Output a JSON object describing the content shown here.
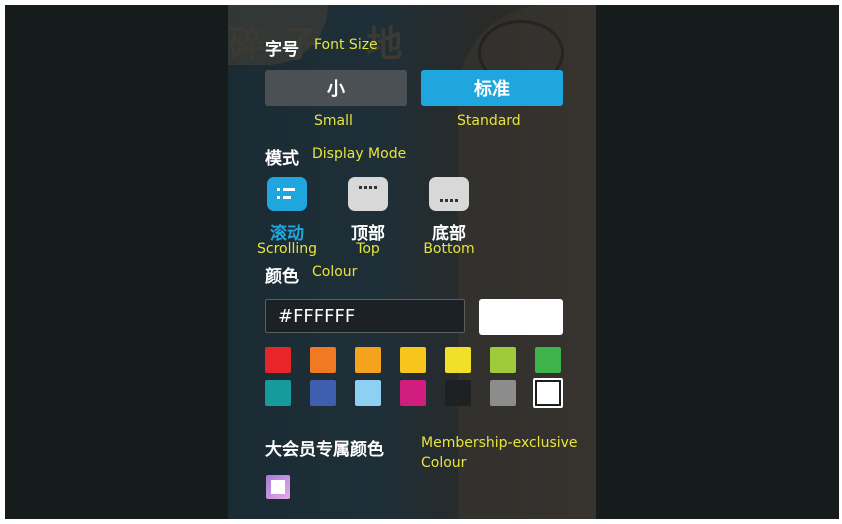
{
  "font_size": {
    "label_cn": "字号",
    "label_en": "Font Size",
    "options": [
      {
        "cn": "小",
        "en": "Small",
        "selected": false
      },
      {
        "cn": "标准",
        "en": "Standard",
        "selected": true
      }
    ]
  },
  "display_mode": {
    "label_cn": "模式",
    "label_en": "Display Mode",
    "options": [
      {
        "cn": "滚动",
        "en": "Scrolling",
        "icon": "scrolling-mode-icon",
        "selected": true
      },
      {
        "cn": "顶部",
        "en": "Top",
        "icon": "top-mode-icon",
        "selected": false
      },
      {
        "cn": "底部",
        "en": "Bottom",
        "icon": "bottom-mode-icon",
        "selected": false
      }
    ]
  },
  "colour": {
    "label_cn": "颜色",
    "label_en": "Colour",
    "hex_value": "#FFFFFF",
    "preview_color": "#FFFFFF",
    "swatches": [
      "#e8262a",
      "#f07a23",
      "#f5a31c",
      "#f7c51c",
      "#f1e02a",
      "#9fcb3a",
      "#3db34a",
      "#169a9c",
      "#3f5fae",
      "#8fd0f2",
      "#d01d7e",
      "#1e2022",
      "#8c8c8c",
      "#ffffff"
    ],
    "selected_swatch": "#ffffff"
  },
  "membership": {
    "label_cn": "大会员专属颜色",
    "label_en_line1": "Membership-exclusive",
    "label_en_line2": "Colour"
  },
  "background_chars": "碎子 地"
}
